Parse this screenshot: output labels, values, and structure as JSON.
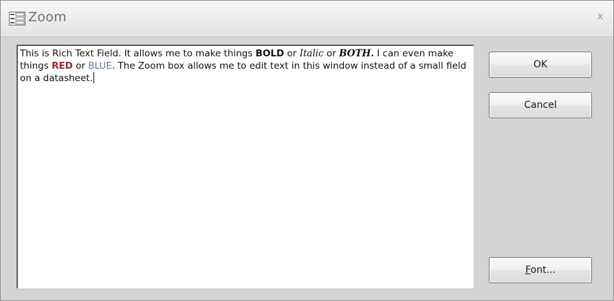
{
  "window": {
    "title": "Zoom",
    "close_glyph": "x",
    "title_icon": "form-icon"
  },
  "editor": {
    "segments": [
      {
        "text": "This  is Rich Text Field.  It allows me to make things ",
        "style": "normal"
      },
      {
        "text": "BOLD",
        "style": "bold"
      },
      {
        "text": " or ",
        "style": "normal"
      },
      {
        "text": "Italic",
        "style": "italic"
      },
      {
        "text": " or ",
        "style": "normal"
      },
      {
        "text": "BOTH.",
        "style": "bold-italic"
      },
      {
        "text": "  I can even make things ",
        "style": "normal"
      },
      {
        "text": "RED",
        "style": "bold-red"
      },
      {
        "text": " or ",
        "style": "normal"
      },
      {
        "text": "BLUE",
        "style": "blue"
      },
      {
        "text": ".  The Zoom box allows me to edit text in this window instead of a small field on a datasheet.",
        "style": "normal"
      }
    ]
  },
  "buttons": {
    "ok_label": "OK",
    "cancel_label": "Cancel",
    "font_label_accel": "F",
    "font_label_rest": "ont..."
  },
  "colors": {
    "red_text": "#9a2a2a",
    "blue_text": "#5a78b0",
    "dialog_bg": "#d4d4d4"
  }
}
